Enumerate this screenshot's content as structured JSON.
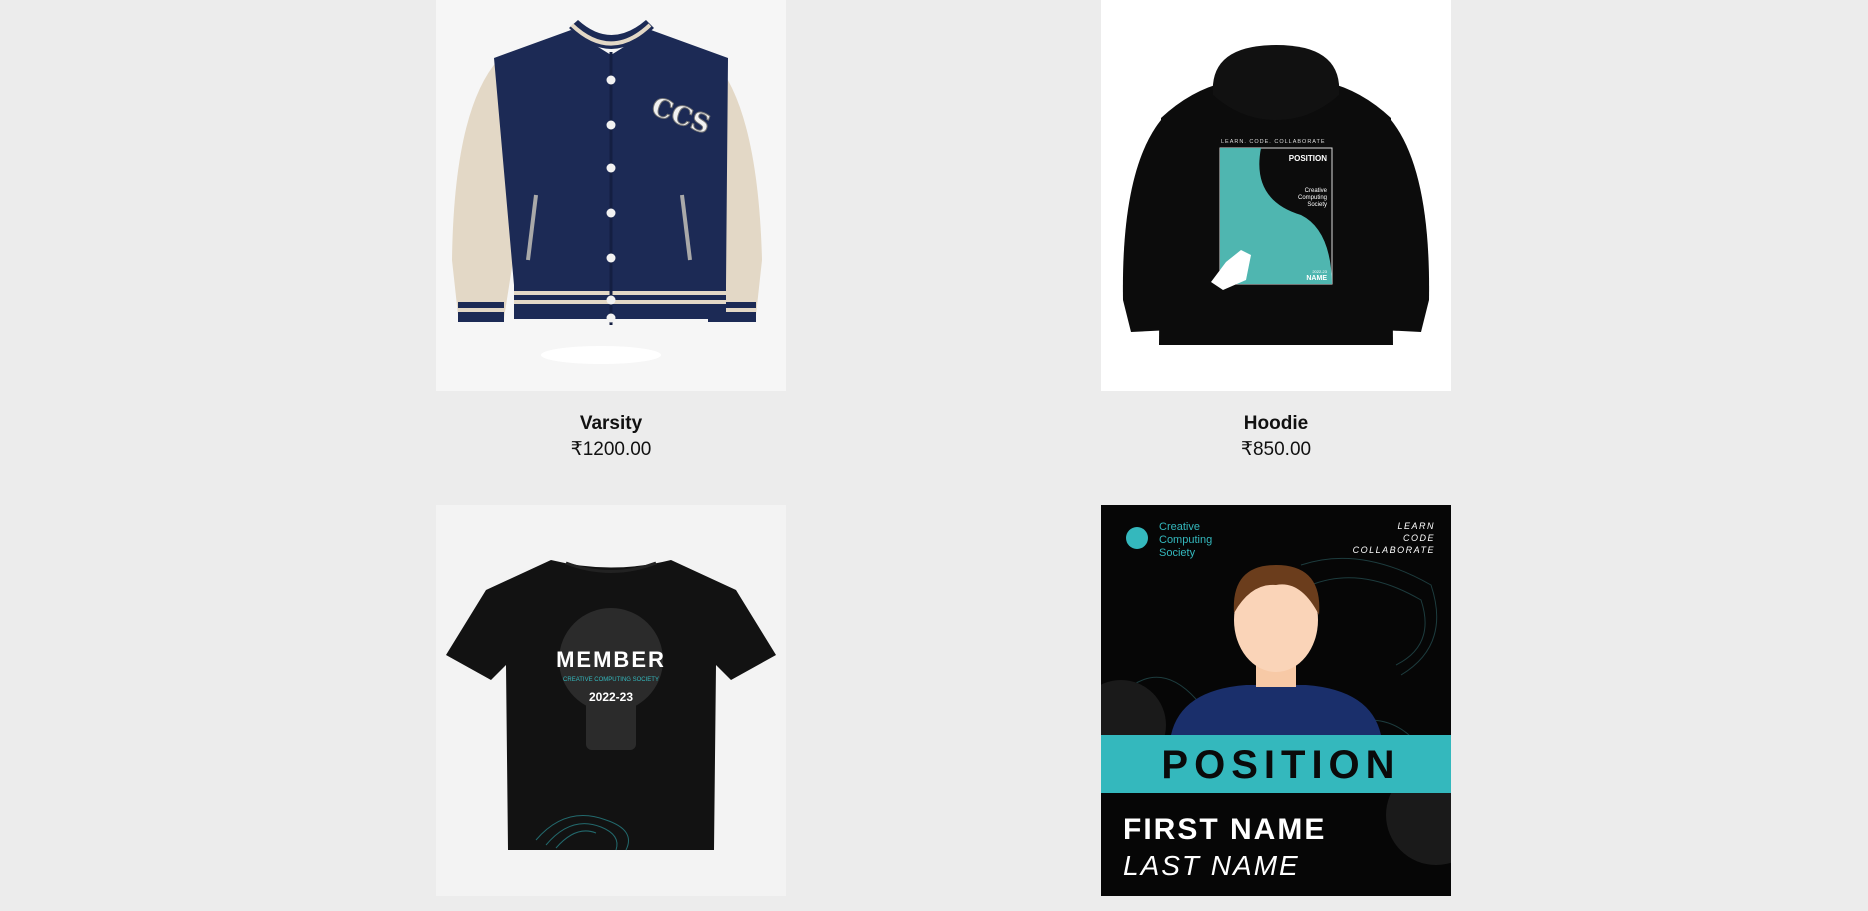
{
  "products": [
    {
      "name": "Varsity",
      "price": "₹1200.00"
    },
    {
      "name": "Hoodie",
      "price": "₹850.00"
    },
    {
      "name": "",
      "price": ""
    },
    {
      "name": "",
      "price": ""
    }
  ],
  "artwork": {
    "jacket_monogram": "CCS",
    "hoodie_tagline": "LEARN. CODE. COLLABORATE",
    "hoodie_position": "POSITION",
    "hoodie_society": [
      "Creative",
      "Computing",
      "Society"
    ],
    "hoodie_year": "2022-23",
    "hoodie_name": "NAME",
    "tee_member": "MEMBER",
    "tee_society": "CREATIVE COMPUTING SOCIETY",
    "tee_year": "2022-23",
    "id_society": [
      "Creative",
      "Computing",
      "Society"
    ],
    "id_tagline": [
      "LEARN",
      "CODE",
      "COLLABORATE"
    ],
    "id_position": "POSITION",
    "id_first_name": "FIRST NAME",
    "id_last_name": "LAST NAME"
  },
  "colors": {
    "page_bg": "#ececec",
    "navy": "#1c2a55",
    "cream": "#e3d8c6",
    "teal": "#34b8bd",
    "black": "#0c0c0c"
  }
}
